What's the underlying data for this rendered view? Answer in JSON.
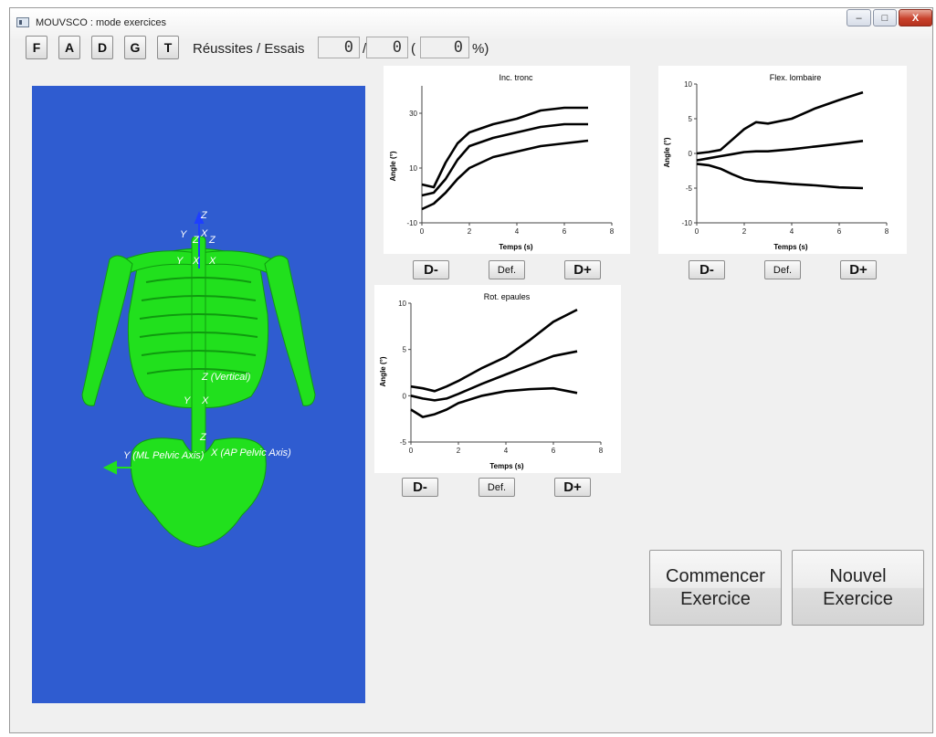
{
  "window": {
    "title": "MOUVSCO : mode exercices",
    "controls": {
      "minimize": "–",
      "maximize": "□",
      "close": "X"
    }
  },
  "toolbar": {
    "buttons": [
      "F",
      "A",
      "D",
      "G",
      "T"
    ],
    "score_label": "Réussites / Essais",
    "successes": "0",
    "separator": "/",
    "attempts": "0",
    "paren_open": "(",
    "percent": "0",
    "percent_suffix": "%)"
  },
  "viewport": {
    "labels": [
      "Z",
      "Y",
      "Z",
      "X",
      "Z",
      "Y",
      "X",
      "X",
      "Z (Vertical)",
      "Y",
      "X",
      "Z",
      "Y (ML Pelvic Axis)",
      "X (AP Pelvic Axis)"
    ],
    "colors": {
      "background": "#2f5cd0",
      "bone": "#21e01d",
      "axis": "#1e3fff"
    }
  },
  "plots": [
    {
      "title": "Inc. tronc",
      "ylabel": "Angle (°)",
      "xlabel": "Temps (s)",
      "xticks": [
        "0",
        "2",
        "4",
        "6",
        "8"
      ],
      "yticks": [
        "-10",
        "10",
        "30"
      ],
      "buttons": {
        "minus": "D-",
        "def": "Def.",
        "plus": "D+"
      }
    },
    {
      "title": "Flex. lombaire",
      "ylabel": "Angle (°)",
      "xlabel": "Temps (s)",
      "xticks": [
        "0",
        "2",
        "4",
        "6",
        "8"
      ],
      "yticks": [
        "-10",
        "-5",
        "0",
        "5",
        "10"
      ],
      "buttons": {
        "minus": "D-",
        "def": "Def.",
        "plus": "D+"
      }
    },
    {
      "title": "Rot. epaules",
      "ylabel": "Angle (°)",
      "xlabel": "Temps (s)",
      "xticks": [
        "0",
        "2",
        "4",
        "6",
        "8"
      ],
      "yticks": [
        "-5",
        "0",
        "5",
        "10"
      ],
      "buttons": {
        "minus": "D-",
        "def": "Def.",
        "plus": "D+"
      }
    }
  ],
  "chart_data": [
    {
      "type": "line",
      "title": "Inc. tronc",
      "xlabel": "Temps (s)",
      "ylabel": "Angle (°)",
      "xlim": [
        0,
        8
      ],
      "ylim": [
        -10,
        40
      ],
      "x": [
        0,
        0.5,
        1,
        1.5,
        2,
        3,
        4,
        5,
        6,
        7
      ],
      "series": [
        {
          "values": [
            4,
            3,
            12,
            19,
            23,
            26,
            28,
            31,
            32,
            32
          ]
        },
        {
          "values": [
            0,
            1,
            6,
            13,
            18,
            21,
            23,
            25,
            26,
            26
          ]
        },
        {
          "values": [
            -5,
            -3,
            1,
            6,
            10,
            14,
            16,
            18,
            19,
            20
          ]
        }
      ]
    },
    {
      "type": "line",
      "title": "Flex. lombaire",
      "xlabel": "Temps (s)",
      "ylabel": "Angle (°)",
      "xlim": [
        0,
        8
      ],
      "ylim": [
        -10,
        10
      ],
      "x": [
        0,
        0.5,
        1,
        1.5,
        2,
        2.5,
        3,
        4,
        5,
        6,
        7
      ],
      "series": [
        {
          "values": [
            0,
            0.2,
            0.5,
            2,
            3.5,
            4.5,
            4.3,
            5,
            6.5,
            7.7,
            8.8
          ]
        },
        {
          "values": [
            -1,
            -0.7,
            -0.4,
            -0.1,
            0.2,
            0.3,
            0.3,
            0.6,
            1,
            1.4,
            1.8
          ]
        },
        {
          "values": [
            -1.5,
            -1.7,
            -2.2,
            -3,
            -3.7,
            -4,
            -4.1,
            -4.4,
            -4.6,
            -4.9,
            -5
          ]
        }
      ]
    },
    {
      "type": "line",
      "title": "Rot. epaules",
      "xlabel": "Temps (s)",
      "ylabel": "Angle (°)",
      "xlim": [
        0,
        8
      ],
      "ylim": [
        -5,
        10
      ],
      "x": [
        0,
        0.5,
        1,
        1.5,
        2,
        3,
        4,
        5,
        6,
        7
      ],
      "series": [
        {
          "values": [
            1,
            0.8,
            0.5,
            1,
            1.6,
            3,
            4.2,
            6,
            8,
            9.3
          ]
        },
        {
          "values": [
            0,
            -0.3,
            -0.5,
            -0.3,
            0.2,
            1.3,
            2.3,
            3.3,
            4.3,
            4.8
          ]
        },
        {
          "values": [
            -1.5,
            -2.3,
            -2,
            -1.5,
            -0.8,
            0,
            0.5,
            0.7,
            0.8,
            0.3
          ]
        }
      ]
    }
  ],
  "actions": {
    "start": [
      "Commencer",
      "Exercice"
    ],
    "new": [
      "Nouvel",
      "Exercice"
    ]
  }
}
